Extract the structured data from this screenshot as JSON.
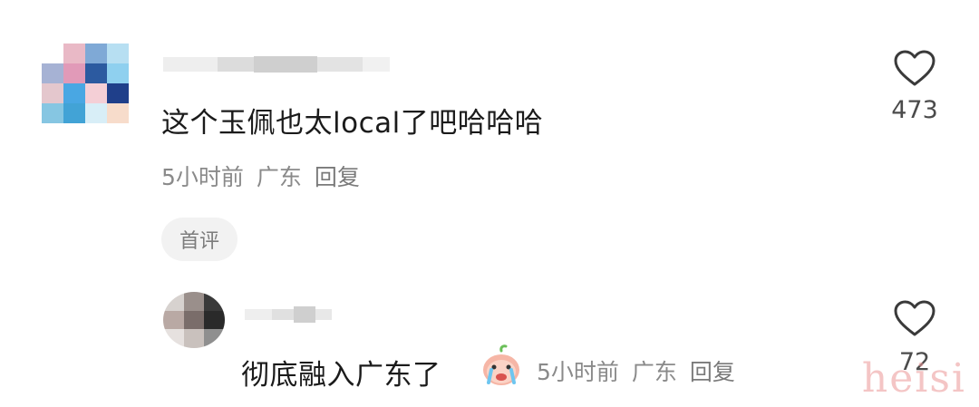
{
  "comments": {
    "main": {
      "text": "这个玉佩也太local了吧哈哈哈",
      "time": "5小时前",
      "location": "广东",
      "reply_label": "回复",
      "badge": "首评",
      "likes": "473"
    },
    "reply": {
      "text": "彻底融入广东了",
      "time": "5小时前",
      "location": "广东",
      "reply_label": "回复",
      "likes": "72"
    }
  },
  "icons": {
    "like": "heart-outline-icon",
    "emoji": "crying-face-emoji-icon"
  },
  "colors": {
    "meta_text": "#8a8a8a",
    "badge_bg": "#f2f2f2"
  },
  "watermark": "heisi"
}
